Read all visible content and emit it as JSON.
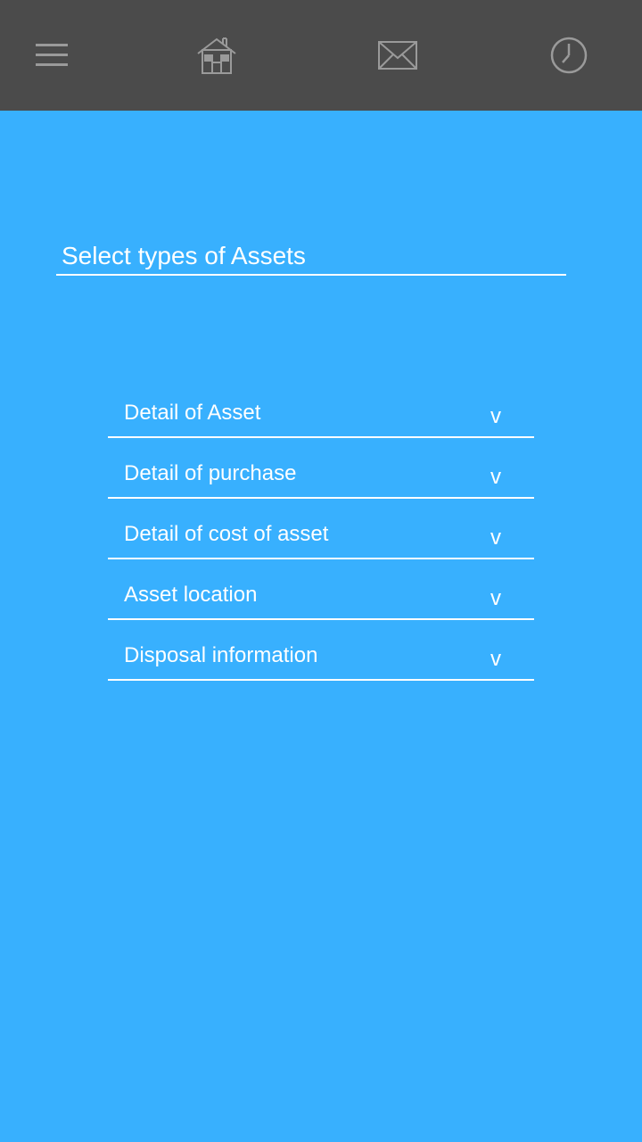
{
  "header": {
    "background": "#4b4b4b",
    "icons": [
      "menu-icon",
      "home-icon",
      "mail-icon",
      "history-icon"
    ]
  },
  "form": {
    "asset_type_value": "Select types of Assets"
  },
  "sections": [
    {
      "label": "Detail of Asset",
      "chevron": "v"
    },
    {
      "label": "Detail of purchase",
      "chevron": "v"
    },
    {
      "label": "Detail of cost of asset",
      "chevron": "v"
    },
    {
      "label": "Asset location",
      "chevron": "v"
    },
    {
      "label": "Disposal information",
      "chevron": "v"
    }
  ],
  "colors": {
    "background": "#38b0fe",
    "text": "#ffffff",
    "icon": "#9a9a9a"
  }
}
